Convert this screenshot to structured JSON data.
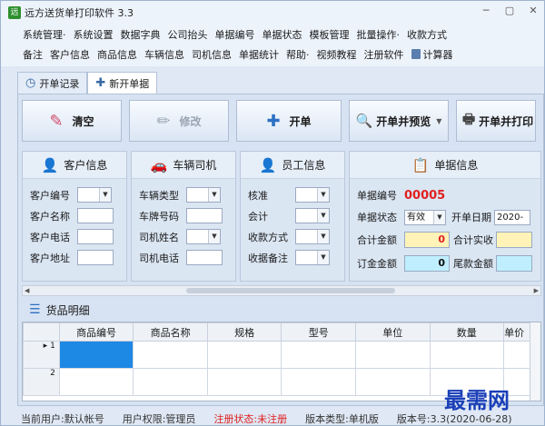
{
  "app": {
    "title": "远方送货单打印软件 3.3"
  },
  "window_controls": [
    "─",
    "▢",
    "✕"
  ],
  "menu": {
    "row1": [
      "系统管理·",
      "系统设置",
      "数据字典",
      "公司抬头",
      "单据编号",
      "单据状态",
      "模板管理",
      "批量操作·",
      "收款方式"
    ],
    "row2": [
      "备注",
      "客户信息",
      "商品信息",
      "车辆信息",
      "司机信息",
      "单据统计",
      "帮助·",
      "视频教程",
      "注册软件",
      "计算器"
    ]
  },
  "tabs": [
    {
      "label": "开单记录",
      "icon": "clock-icon"
    },
    {
      "label": "新开单据",
      "icon": "plus-icon"
    }
  ],
  "toolbar": {
    "clear": "清空",
    "edit": "修改",
    "new_bill": "开单",
    "bill_preview": "开单并预览",
    "bill_print": "开单并打印"
  },
  "groups": {
    "customer": {
      "title": "客户信息",
      "fields": [
        "客户编号",
        "客户名称",
        "客户电话",
        "客户地址"
      ]
    },
    "vehicle": {
      "title": "车辆司机",
      "fields": [
        "车辆类型",
        "车牌号码",
        "司机姓名",
        "司机电话"
      ]
    },
    "staff": {
      "title": "员工信息",
      "fields": [
        "核准",
        "会计",
        "收款方式",
        "收据备注"
      ]
    },
    "bill": {
      "title": "单据信息",
      "number_label": "单据编号",
      "number_value": "00005",
      "status_label": "单据状态",
      "status_value": "有效",
      "date_label": "开单日期",
      "date_value": "2020-",
      "total_label": "合计金额",
      "total_value": "0",
      "received_label": "合计实收",
      "deposit_label": "订金金额",
      "deposit_value": "0",
      "balance_label": "尾款金额"
    }
  },
  "goods": {
    "title": "货品明细",
    "columns": [
      "商品编号",
      "商品名称",
      "规格",
      "型号",
      "单位",
      "数量",
      "单价"
    ],
    "rows": [
      "1",
      "2"
    ]
  },
  "status_bar": {
    "user": "当前用户:默认帐号",
    "role": "用户权限:管理员",
    "register": "注册状态:未注册",
    "edition": "版本类型:单机版",
    "version": "版本号:3.3(2020-06-28)"
  },
  "watermark": "最需网",
  "colors": {
    "accent_red": "#e02020",
    "selected_cell": "#1e88e5",
    "total_bg": "#fff3b8",
    "deposit_bg": "#bfefff",
    "brand_green": "#2d8f2d"
  }
}
